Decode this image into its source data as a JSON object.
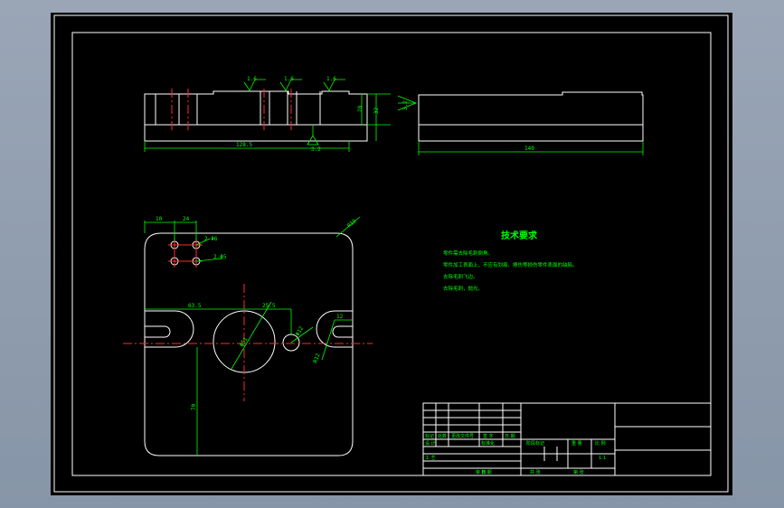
{
  "drawing": {
    "roughness_marks": [
      "1.6",
      "1.6",
      "1.6",
      "3.2",
      "3.2"
    ],
    "dimensions": {
      "front_width": "128.5",
      "front_height_inner": "28",
      "front_height_outer": "32",
      "side_width": "140",
      "top_left_offset_1": "10",
      "top_left_offset_2": "24",
      "corner_radius": "R10",
      "left_slot_width": "63.5",
      "big_bore_offset": "25.5",
      "small_hole": "Φ12",
      "right_slot_width": "12",
      "right_slot_radius": "R12",
      "big_bore_dia": "Φ51",
      "vertical_dim": "70",
      "hole_callout_1": "2-Φ6",
      "hole_callout_2": "2-Φ5"
    }
  },
  "tech_requirements": {
    "title": "技术要求",
    "notes": [
      "零件需去除毛刺倒角。",
      "零件加工表面上，不应有划痕、擦伤等损伤零件表面的缺陷。",
      "去除毛刺飞边。",
      "去除毛刺，抛光。"
    ]
  },
  "title_block": {
    "r1": [
      "标记",
      "处数",
      "更改文件号",
      "签 字",
      "日 期"
    ],
    "r2": [
      "设 计",
      "标准化",
      "阶段标记",
      "重 量",
      "比 例"
    ],
    "scale": "1:1",
    "r3": [
      "审 核",
      "共 张",
      "第 张"
    ],
    "r4": [
      "工 艺",
      "日 期"
    ]
  }
}
